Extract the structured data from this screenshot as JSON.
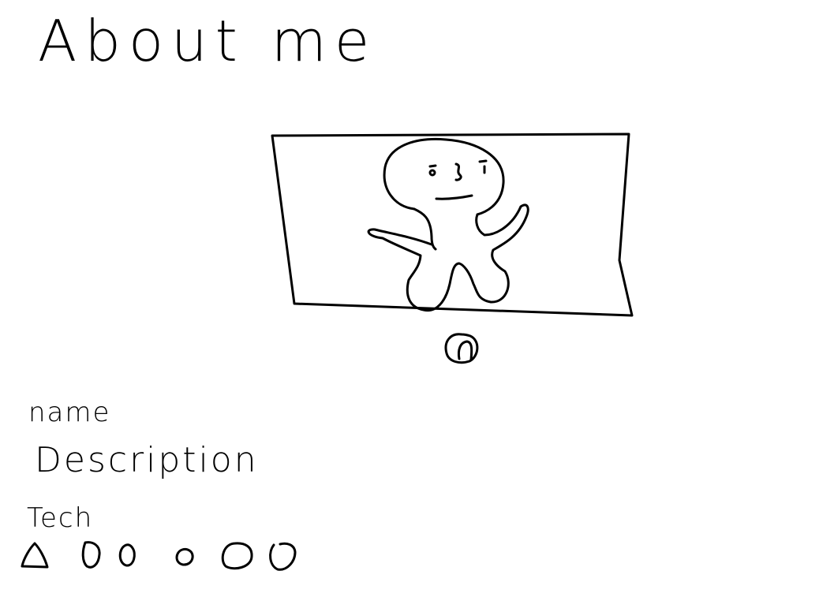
{
  "page": {
    "title": "About me"
  },
  "profile": {
    "photo_icon": "stick-figure-avatar",
    "upload_icon": "upload-circle-icon"
  },
  "fields": {
    "name_label": "name",
    "description_label": "Description",
    "tech_label": "Tech"
  },
  "tech": {
    "icons": [
      "tech-icon-1",
      "tech-icon-2",
      "tech-icon-3",
      "tech-icon-4",
      "tech-icon-5",
      "tech-icon-6"
    ]
  }
}
